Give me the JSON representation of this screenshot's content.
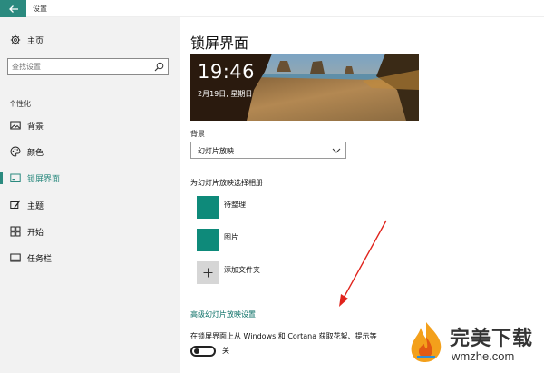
{
  "window": {
    "title": "设置"
  },
  "sidebar": {
    "home_label": "主页",
    "search_placeholder": "查找设置",
    "section_header": "个性化",
    "items": [
      {
        "label": "背景",
        "icon": "image-icon",
        "active": false
      },
      {
        "label": "颜色",
        "icon": "palette-icon",
        "active": false
      },
      {
        "label": "锁屏界面",
        "icon": "lock-screen-icon",
        "active": true
      },
      {
        "label": "主题",
        "icon": "brush-icon",
        "active": false
      },
      {
        "label": "开始",
        "icon": "start-icon",
        "active": false
      },
      {
        "label": "任务栏",
        "icon": "taskbar-icon",
        "active": false
      }
    ]
  },
  "main": {
    "title": "锁屏界面",
    "preview": {
      "time": "19:46",
      "date": "2月19日, 星期日"
    },
    "background_label": "背景",
    "background_value": "幻灯片放映",
    "album_label": "为幻灯片放映选择相册",
    "albums": [
      {
        "name": "待整理"
      },
      {
        "name": "图片"
      }
    ],
    "add_folder_label": "添加文件夹",
    "advanced_link": "高级幻灯片放映设置",
    "cortana_text": "在锁屏界面上从 Windows 和 Cortana 获取花絮、提示等",
    "toggle_state": "关"
  },
  "watermark": {
    "cn": "完美下载",
    "en": "wmzhe.com"
  },
  "colors": {
    "accent": "#2b8a7f",
    "swatch": "#0e8a7a",
    "arrow": "#e0231c"
  }
}
